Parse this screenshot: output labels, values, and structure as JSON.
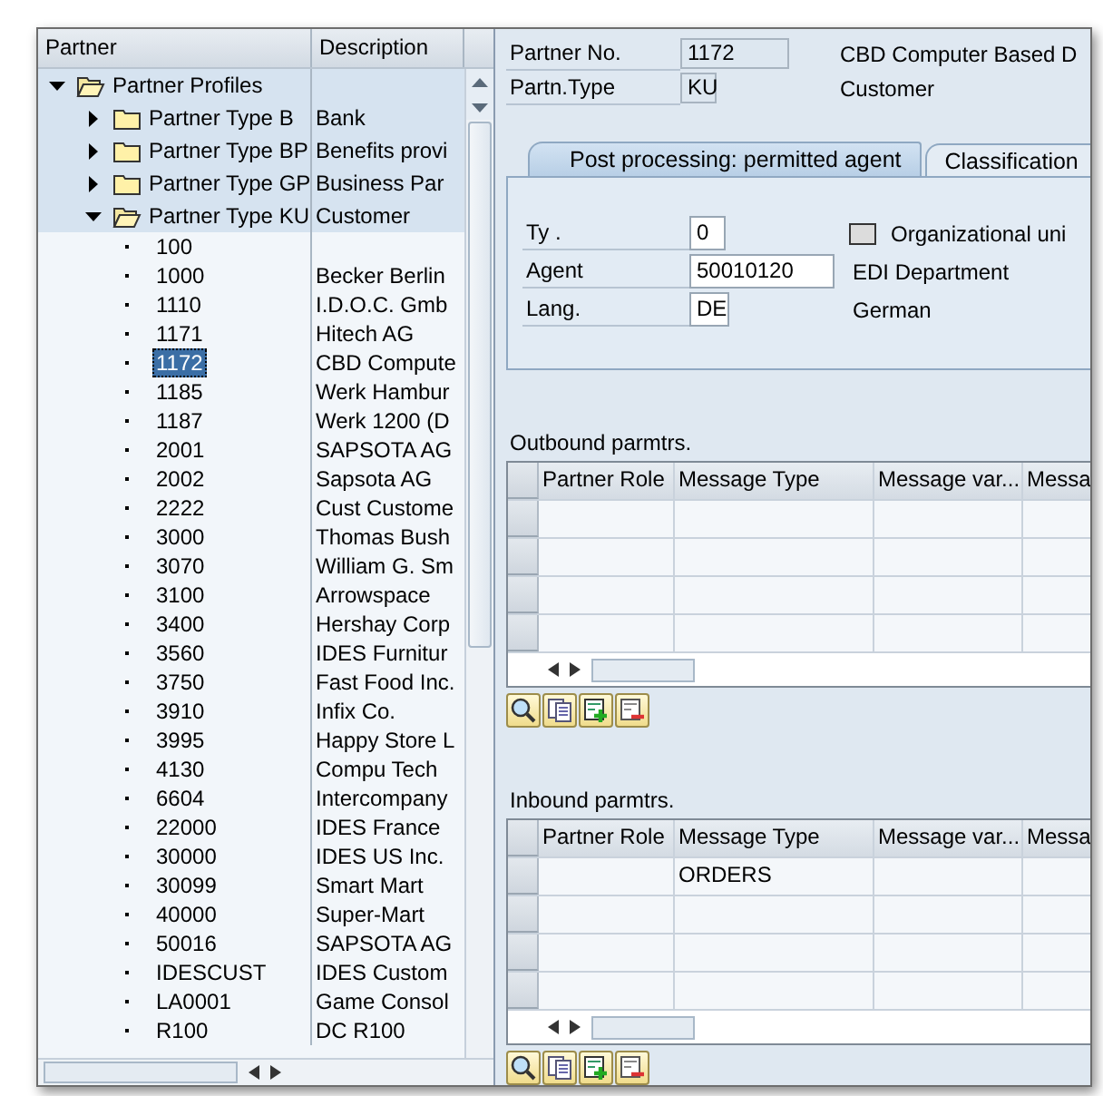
{
  "tree": {
    "columns": [
      "Partner",
      "Description"
    ],
    "root": {
      "label": "Partner Profiles",
      "expanded": true,
      "children": [
        {
          "label": "Partner Type B",
          "description": "Bank",
          "expanded": false
        },
        {
          "label": "Partner Type BP",
          "description": "Benefits provi",
          "expanded": false
        },
        {
          "label": "Partner Type GP",
          "description": "Business Par",
          "expanded": false
        },
        {
          "label": "Partner Type KU",
          "description": "Customer",
          "expanded": true,
          "children": [
            {
              "label": "100",
              "selected": false
            },
            {
              "label": "1000",
              "description": "Becker Berlin",
              "selected": false
            },
            {
              "label": "1110",
              "description": "I.D.O.C. Gmb",
              "selected": false
            },
            {
              "label": "1171",
              "description": "Hitech AG",
              "selected": false
            },
            {
              "label": "1172",
              "description": "CBD Compute",
              "selected": true
            },
            {
              "label": "1185",
              "description": "Werk Hambur",
              "selected": false
            },
            {
              "label": "1187",
              "description": "Werk 1200 (D",
              "selected": false
            },
            {
              "label": "2001",
              "description": "SAPSOTA AG",
              "selected": false
            },
            {
              "label": "2002",
              "description": "Sapsota AG",
              "selected": false
            },
            {
              "label": "2222",
              "description": "Cust Custome",
              "selected": false
            },
            {
              "label": "3000",
              "description": "Thomas Bush",
              "selected": false
            },
            {
              "label": "3070",
              "description": "William G. Sm",
              "selected": false
            },
            {
              "label": "3100",
              "description": "Arrowspace",
              "selected": false
            },
            {
              "label": "3400",
              "description": "Hershay Corp",
              "selected": false
            },
            {
              "label": "3560",
              "description": "IDES Furnitur",
              "selected": false
            },
            {
              "label": "3750",
              "description": "Fast Food Inc.",
              "selected": false
            },
            {
              "label": "3910",
              "description": "Infix Co.",
              "selected": false
            },
            {
              "label": "3995",
              "description": "Happy Store L",
              "selected": false
            },
            {
              "label": "4130",
              "description": "Compu Tech",
              "selected": false
            },
            {
              "label": "6604",
              "description": "Intercompany",
              "selected": false
            },
            {
              "label": "22000",
              "description": "IDES France",
              "selected": false
            },
            {
              "label": "30000",
              "description": "IDES US Inc.",
              "selected": false
            },
            {
              "label": "30099",
              "description": "Smart Mart",
              "selected": false
            },
            {
              "label": "40000",
              "description": "Super-Mart",
              "selected": false
            },
            {
              "label": "50016",
              "description": "SAPSOTA AG",
              "selected": false
            },
            {
              "label": "IDESCUST",
              "description": "IDES Custom",
              "selected": false
            },
            {
              "label": "LA0001",
              "description": "Game Consol",
              "selected": false
            },
            {
              "label": "R100",
              "description": "DC R100",
              "selected": false
            }
          ]
        }
      ]
    }
  },
  "header": {
    "fields": [
      {
        "label": "Partner No.",
        "value": "1172",
        "description": "CBD Computer Based D"
      },
      {
        "label": "Partn.Type",
        "value": "KU",
        "description": "Customer"
      }
    ]
  },
  "tabs": [
    {
      "label": "Post processing: permitted agent",
      "selected": true
    },
    {
      "label": "Classification",
      "selected": false
    }
  ],
  "agent_panel": {
    "fields": [
      {
        "label": "Ty .",
        "value": "0",
        "kind": "checkbox",
        "checkbox_label": "Organizational uni",
        "checked": false
      },
      {
        "label": "Agent",
        "value": "50010120",
        "kind": "text",
        "description": "EDI Department"
      },
      {
        "label": "Lang.",
        "value": "DE",
        "kind": "text",
        "description": "German"
      }
    ]
  },
  "outbound": {
    "title": "Outbound parmtrs.",
    "columns": [
      "Partner Role",
      "Message Type",
      "Message var...",
      "Messa"
    ]
  },
  "inbound": {
    "title": "Inbound parmtrs.",
    "columns": [
      "Partner Role",
      "Message Type",
      "Message var...",
      "Messa"
    ],
    "rows": [
      {
        "message_type": "ORDERS"
      }
    ]
  }
}
